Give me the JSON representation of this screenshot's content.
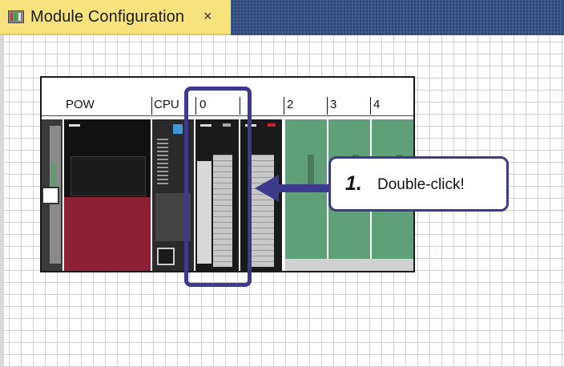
{
  "tab": {
    "title": "Module Configuration",
    "close": "×"
  },
  "base": {
    "slots": [
      {
        "label": "POW"
      },
      {
        "label": "CPU"
      },
      {
        "label": "0"
      },
      {
        "label": "2"
      },
      {
        "label": "3"
      },
      {
        "label": "4"
      }
    ]
  },
  "callout": {
    "step": "1.",
    "text": "Double-click!"
  },
  "colors": {
    "accent": "#3b3a8c",
    "tab_bg": "#f7e27c",
    "power_supply": "#8e1f35",
    "io_module_green": "#5fa079"
  }
}
